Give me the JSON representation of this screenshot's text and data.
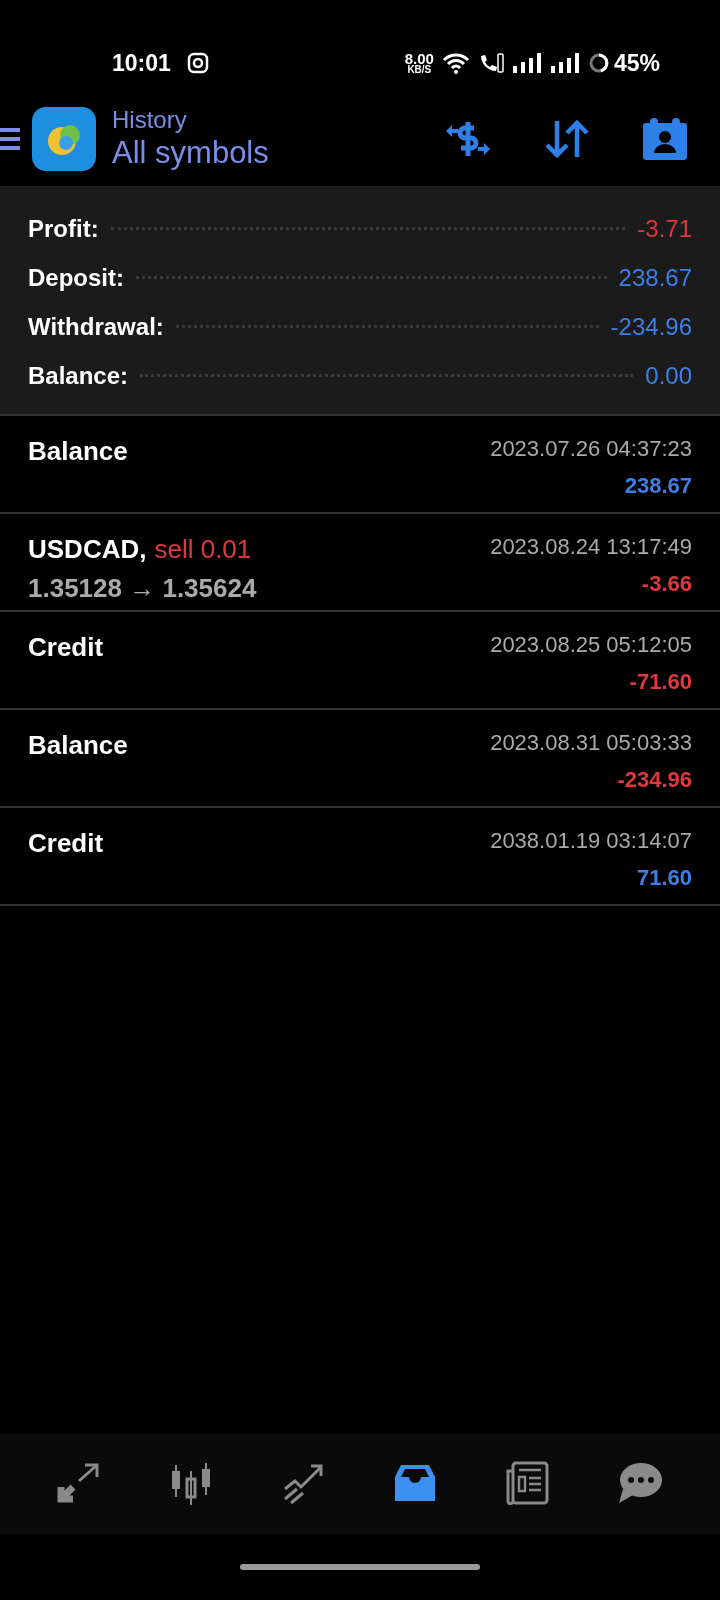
{
  "status_bar": {
    "time": "10:01",
    "net_speed": "8.00",
    "net_unit": "KB/S",
    "battery": "45%"
  },
  "header": {
    "title": "History",
    "subtitle": "All symbols"
  },
  "summary": [
    {
      "label": "Profit:",
      "value": "-3.71",
      "color": "#e0383e"
    },
    {
      "label": "Deposit:",
      "value": "238.67",
      "color": "#3d7fe6"
    },
    {
      "label": "Withdrawal:",
      "value": "-234.96",
      "color": "#3d7fe6"
    },
    {
      "label": "Balance:",
      "value": "0.00",
      "color": "#3d7fe6"
    }
  ],
  "deals": [
    {
      "title": "Balance",
      "time": "2023.07.26 04:37:23",
      "amount": "238.67",
      "color": "#3d7fe6"
    },
    {
      "title": "USDCAD,",
      "action": "sell 0.01",
      "prices": "1.35128 → 1.35624",
      "time": "2023.08.24 13:17:49",
      "amount": "-3.66",
      "color": "#e0383e"
    },
    {
      "title": "Credit",
      "time": "2023.08.25 05:12:05",
      "amount": "-71.60",
      "color": "#e0383e"
    },
    {
      "title": "Balance",
      "time": "2023.08.31 05:03:33",
      "amount": "-234.96",
      "color": "#e0383e"
    },
    {
      "title": "Credit",
      "time": "2038.01.19 03:14:07",
      "amount": "71.60",
      "color": "#3d7fe6"
    }
  ],
  "bottom_nav": [
    {
      "kind": "quotes",
      "selected": false
    },
    {
      "kind": "chart",
      "selected": false
    },
    {
      "kind": "trade",
      "selected": false
    },
    {
      "kind": "history",
      "selected": true
    },
    {
      "kind": "news",
      "selected": false
    },
    {
      "kind": "chat",
      "selected": false
    }
  ]
}
